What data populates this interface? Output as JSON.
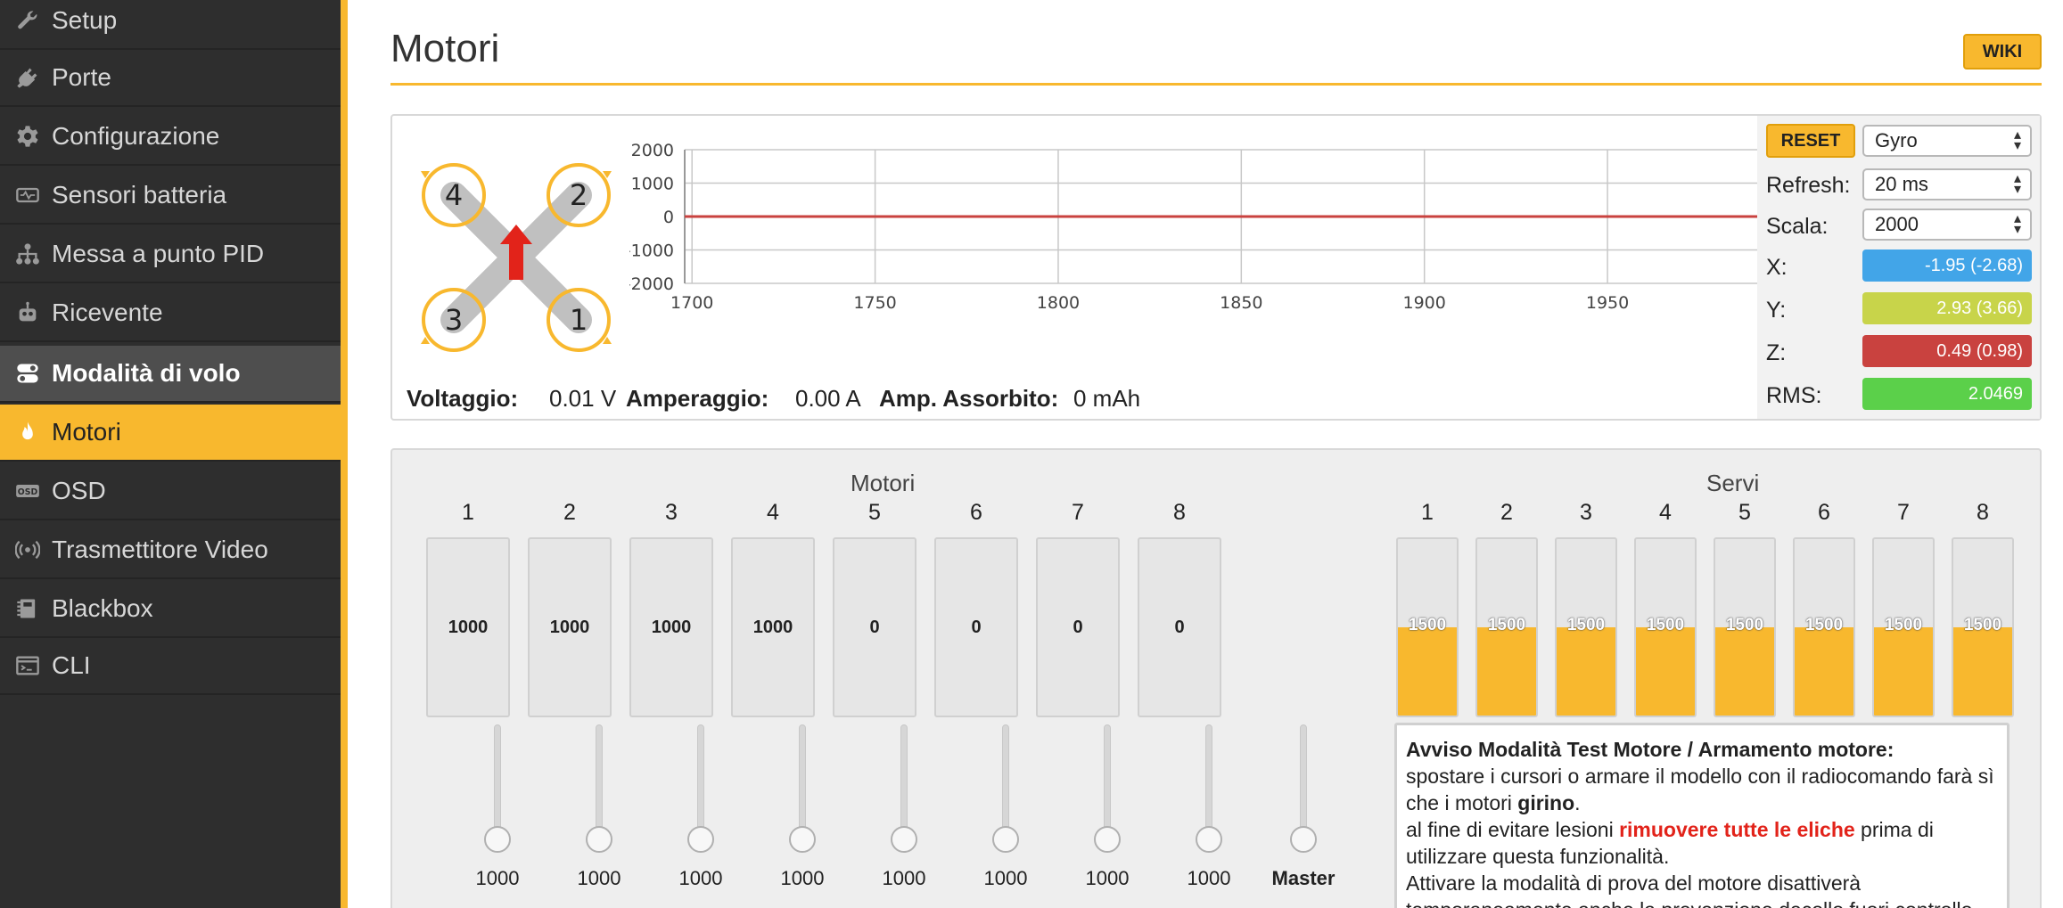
{
  "sidebar": {
    "items": [
      {
        "label": "Setup",
        "icon": "wrench-icon"
      },
      {
        "label": "Porte",
        "icon": "plug-icon"
      },
      {
        "label": "Configurazione",
        "icon": "gear-icon"
      },
      {
        "label": "Sensori batteria",
        "icon": "battery-icon"
      },
      {
        "label": "Messa a punto PID",
        "icon": "sitemap-icon"
      },
      {
        "label": "Ricevente",
        "icon": "robot-icon"
      },
      {
        "label": "Modalità di volo",
        "icon": "toggle-icon"
      },
      {
        "label": "Motori",
        "icon": "flame-icon"
      },
      {
        "label": "OSD",
        "icon": "osd-icon"
      },
      {
        "label": "Trasmettitore Video",
        "icon": "broadcast-icon"
      },
      {
        "label": "Blackbox",
        "icon": "blackbox-icon"
      },
      {
        "label": "CLI",
        "icon": "terminal-icon"
      }
    ],
    "active": "Motori",
    "accent_color": "#f8b82e"
  },
  "header": {
    "title": "Motori",
    "wiki_label": "WIKI"
  },
  "quad_diagram": {
    "motor_labels": [
      "4",
      "2",
      "3",
      "1"
    ]
  },
  "readouts": {
    "voltage_label": "Voltaggio:",
    "voltage_value": "0.01 V",
    "current_label": "Amperaggio:",
    "current_value": "0.00 A",
    "consumed_label": "Amp. Assorbito:",
    "consumed_value": "0 mAh"
  },
  "chart_data": {
    "type": "line",
    "x_ticks": [
      1700,
      1750,
      1800,
      1850,
      1900,
      1950
    ],
    "y_ticks": [
      2000,
      1000,
      0,
      -1000,
      -2000
    ],
    "xlim": [
      1698,
      1996
    ],
    "ylim": [
      -2000,
      2000
    ],
    "grid": true,
    "series": [
      {
        "color": "#6fa8dc",
        "x": [
          1698,
          1996
        ],
        "values": [
          0,
          0
        ]
      },
      {
        "color": "#c8d44a",
        "x": [
          1698,
          1996
        ],
        "values": [
          0,
          0
        ]
      },
      {
        "color": "#c9423f",
        "x": [
          1698,
          1996
        ],
        "values": [
          0,
          0
        ]
      }
    ]
  },
  "controls": {
    "reset_label": "RESET",
    "sensor_select": "Gyro",
    "refresh_label": "Refresh:",
    "refresh_value": "20 ms",
    "scale_label": "Scala:",
    "scale_value": "2000",
    "x_label": "X:",
    "x_value": "-1.95 (-2.68)",
    "y_label": "Y:",
    "y_value": "2.93 (3.66)",
    "z_label": "Z:",
    "z_value": "0.49 (0.98)",
    "rms_label": "RMS:",
    "rms_value": "2.0469",
    "colors": {
      "x": "#42a5e8",
      "y": "#c8d44a",
      "z": "#c9423f",
      "rms": "#5bd04a"
    }
  },
  "motors": {
    "title": "Motori",
    "labels": [
      "1",
      "2",
      "3",
      "4",
      "5",
      "6",
      "7",
      "8"
    ],
    "values": [
      "1000",
      "1000",
      "1000",
      "1000",
      "0",
      "0",
      "0",
      "0"
    ],
    "slider_values": [
      "1000",
      "1000",
      "1000",
      "1000",
      "1000",
      "1000",
      "1000",
      "1000"
    ],
    "master_label": "Master"
  },
  "servos": {
    "title": "Servi",
    "labels": [
      "1",
      "2",
      "3",
      "4",
      "5",
      "6",
      "7",
      "8"
    ],
    "values": [
      "1500",
      "1500",
      "1500",
      "1500",
      "1500",
      "1500",
      "1500",
      "1500"
    ],
    "fill_fraction": 0.5
  },
  "warning": {
    "title": "Avviso Modalità Test Motore / Armamento motore:",
    "line1": "spostare i cursori o armare il modello con il radiocomando farà sì che i motori ",
    "line1_bold": "girino",
    "line1_end": ".",
    "line2": "al fine di evitare lesioni ",
    "line2_red": "rimuovere tutte le eliche",
    "line2_end": " prima di utilizzare questa funzionalità.",
    "line3": "Attivare la modalità di prova del motore disattiverà temporaneamente anche la prevenzione decollo fuori controllo"
  }
}
